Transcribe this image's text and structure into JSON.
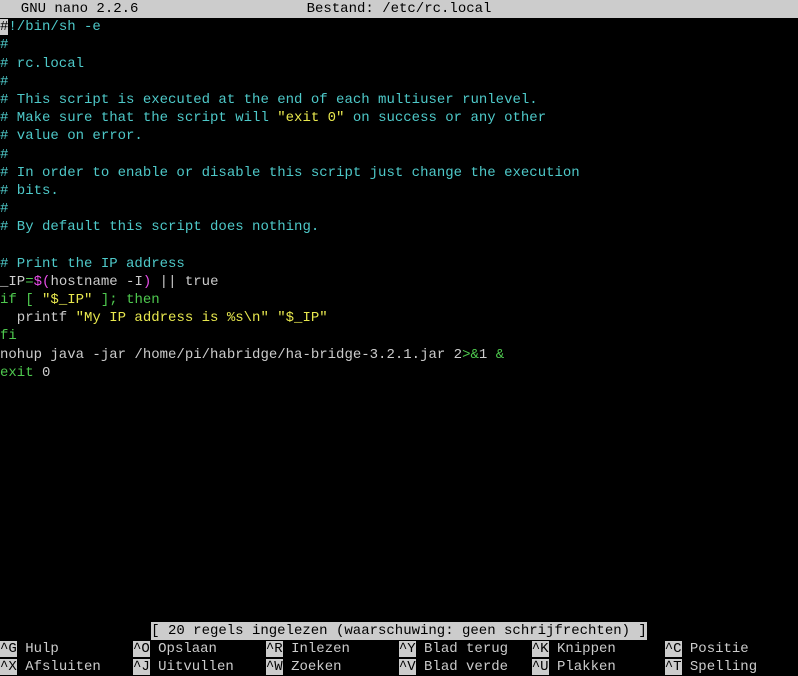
{
  "titlebar": {
    "app": "  GNU nano 2.2.6",
    "file_label": "Bestand:",
    "file_path": "/etc/rc.local"
  },
  "lines": [
    [
      {
        "cls": "cursor",
        "t": "#"
      },
      {
        "cls": "teal",
        "t": "!/bin/sh -e"
      }
    ],
    [
      {
        "cls": "teal",
        "t": "#"
      }
    ],
    [
      {
        "cls": "teal",
        "t": "# rc.local"
      }
    ],
    [
      {
        "cls": "teal",
        "t": "#"
      }
    ],
    [
      {
        "cls": "teal",
        "t": "# This script is executed at the end of each multiuser runlevel."
      }
    ],
    [
      {
        "cls": "teal",
        "t": "# Make sure that the script will "
      },
      {
        "cls": "yellow",
        "t": "\"exit 0\""
      },
      {
        "cls": "teal",
        "t": " on success or any other"
      }
    ],
    [
      {
        "cls": "teal",
        "t": "# value on error."
      }
    ],
    [
      {
        "cls": "teal",
        "t": "#"
      }
    ],
    [
      {
        "cls": "teal",
        "t": "# In order to enable or disable this script just change the execution"
      }
    ],
    [
      {
        "cls": "teal",
        "t": "# bits."
      }
    ],
    [
      {
        "cls": "teal",
        "t": "#"
      }
    ],
    [
      {
        "cls": "teal",
        "t": "# By default this script does nothing."
      }
    ],
    [],
    [
      {
        "cls": "teal",
        "t": "# Print the IP address"
      }
    ],
    [
      {
        "cls": "white",
        "t": "_IP"
      },
      {
        "cls": "green",
        "t": "="
      },
      {
        "cls": "magenta",
        "t": "$("
      },
      {
        "cls": "white",
        "t": "hostname -I"
      },
      {
        "cls": "magenta",
        "t": ")"
      },
      {
        "cls": "white",
        "t": " || true"
      }
    ],
    [
      {
        "cls": "green",
        "t": "if"
      },
      {
        "cls": "white",
        "t": " "
      },
      {
        "cls": "green",
        "t": "["
      },
      {
        "cls": "white",
        "t": " "
      },
      {
        "cls": "yellow",
        "t": "\"$_IP\""
      },
      {
        "cls": "white",
        "t": " "
      },
      {
        "cls": "green",
        "t": "];"
      },
      {
        "cls": "white",
        "t": " "
      },
      {
        "cls": "green",
        "t": "then"
      }
    ],
    [
      {
        "cls": "white",
        "t": "  printf "
      },
      {
        "cls": "yellow",
        "t": "\"My IP address is %s\\n\" \"$_IP\""
      }
    ],
    [
      {
        "cls": "green",
        "t": "fi"
      }
    ],
    [
      {
        "cls": "white",
        "t": "nohup java -jar /home/pi/habridge/ha-bridge-3.2.1.jar 2"
      },
      {
        "cls": "green",
        "t": ">&"
      },
      {
        "cls": "white",
        "t": "1 "
      },
      {
        "cls": "green",
        "t": "&"
      }
    ],
    [
      {
        "cls": "green",
        "t": "exit"
      },
      {
        "cls": "white",
        "t": " 0"
      }
    ]
  ],
  "status": "[ 20 regels ingelezen (waarschuwing: geen schrijfrechten) ]",
  "shortcuts": [
    {
      "key": "^G",
      "desc": " Hulp"
    },
    {
      "key": "^O",
      "desc": " Opslaan"
    },
    {
      "key": "^R",
      "desc": " Inlezen"
    },
    {
      "key": "^Y",
      "desc": " Blad terug"
    },
    {
      "key": "^K",
      "desc": " Knippen"
    },
    {
      "key": "^C",
      "desc": " Positie"
    },
    {
      "key": "^X",
      "desc": " Afsluiten"
    },
    {
      "key": "^J",
      "desc": " Uitvullen"
    },
    {
      "key": "^W",
      "desc": " Zoeken"
    },
    {
      "key": "^V",
      "desc": " Blad verde"
    },
    {
      "key": "^U",
      "desc": " Plakken"
    },
    {
      "key": "^T",
      "desc": " Spelling"
    }
  ]
}
